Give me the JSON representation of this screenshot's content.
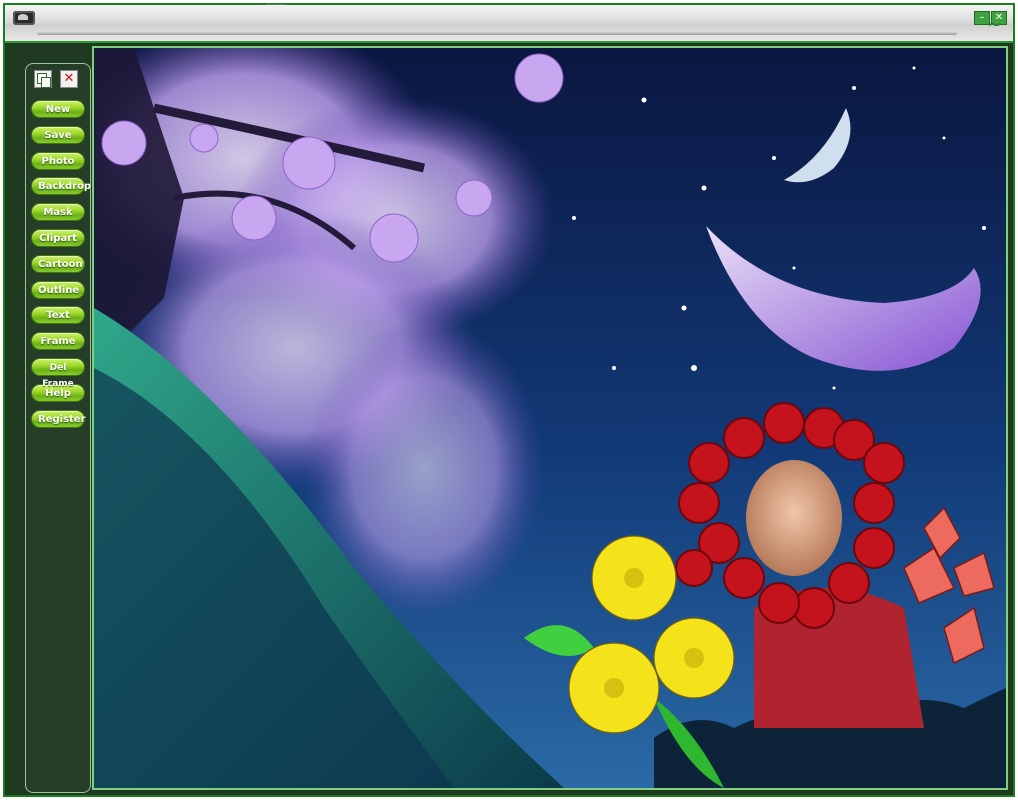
{
  "window": {
    "icons": {
      "app": "app-icon",
      "minimize": "minimize-icon",
      "close": "close-icon",
      "wave": "wave-icon"
    },
    "controls": {
      "minimize_glyph": "–",
      "close_glyph": "✕",
      "wave_glyph": "~"
    }
  },
  "toolbar": {
    "icons": [
      "copy-icon",
      "close-icon"
    ],
    "close_glyph": "✕",
    "buttons": [
      {
        "label": "New"
      },
      {
        "label": "Save"
      },
      {
        "label": "Photo"
      },
      {
        "label": "Backdrop"
      },
      {
        "label": "Mask"
      },
      {
        "label": "Clipart"
      },
      {
        "label": "Cartoon"
      },
      {
        "label": "Outline"
      },
      {
        "label": "Text"
      },
      {
        "label": "Frame"
      },
      {
        "label": "Del Frame"
      },
      {
        "label": "Help"
      },
      {
        "label": "Register"
      }
    ]
  },
  "colors": {
    "accent": "#1b7d1d",
    "button_green": "#9fd92a",
    "panel": "#263d27",
    "night_sky": "#0c1b45"
  }
}
